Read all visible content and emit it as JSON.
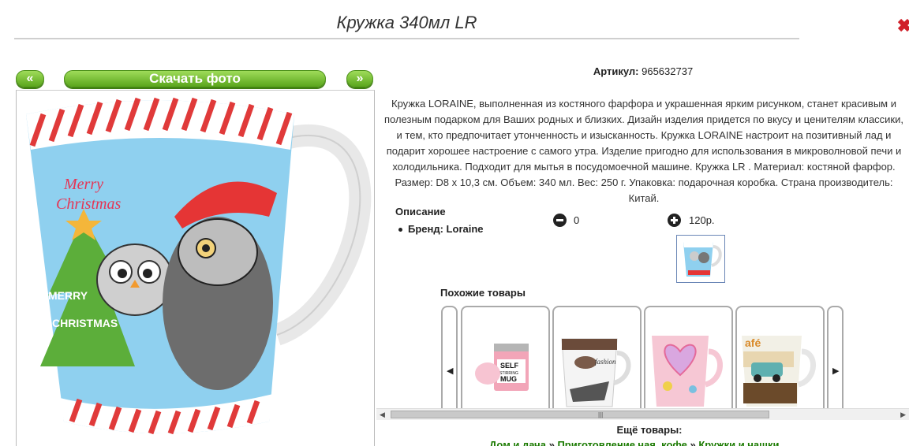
{
  "product": {
    "title": "Кружка 340мл LR",
    "sku_label": "Артикул:",
    "sku_value": "965632737",
    "description": "Кружка LORAINE, выполненная из костяного фарфора и украшенная ярким рисунком, станет красивым и полезным подарком для Ваших родных и близких. Дизайн изделия придется по вкусу и ценителям классики, и тем, кто предпочитает утонченность и изысканность. Кружка LORAINE настроит на позитивный лад и подарит хорошее настроение с самого утра. Изделие пригодно для использования в микроволновой печи и холодильника. Подходит для мытья в посудомоечной машине. Кружка LR . Материал: костяной фарфор. Размер: D8 x 10,3 см. Объем: 340 мл. Вес: 250 г. Упаковка: подарочная коробка. Страна производитель: Китай.",
    "opisanie": "Описание",
    "brand": "Бренд: Loraine",
    "quantity": "0",
    "price": "120р."
  },
  "gallery": {
    "prev_label": "«",
    "next_label": "»",
    "download_label": "Скачать фото"
  },
  "similar": {
    "title": "Похожие товары",
    "left_arrow": "◀",
    "right_arrow": "▶",
    "items": [
      {
        "name": "self-stirring-mug"
      },
      {
        "name": "fashion-mug"
      },
      {
        "name": "heart-mug"
      },
      {
        "name": "car-mug"
      }
    ]
  },
  "more": {
    "title": "Ещё товары:",
    "crumb1": "Дом и дача",
    "sep": " » ",
    "crumb2": "Приготовление чая, кофе",
    "crumb3": "Кружки и чашки"
  },
  "colors": {
    "accent_green": "#5aa51c",
    "link_green": "#1a7a00"
  }
}
